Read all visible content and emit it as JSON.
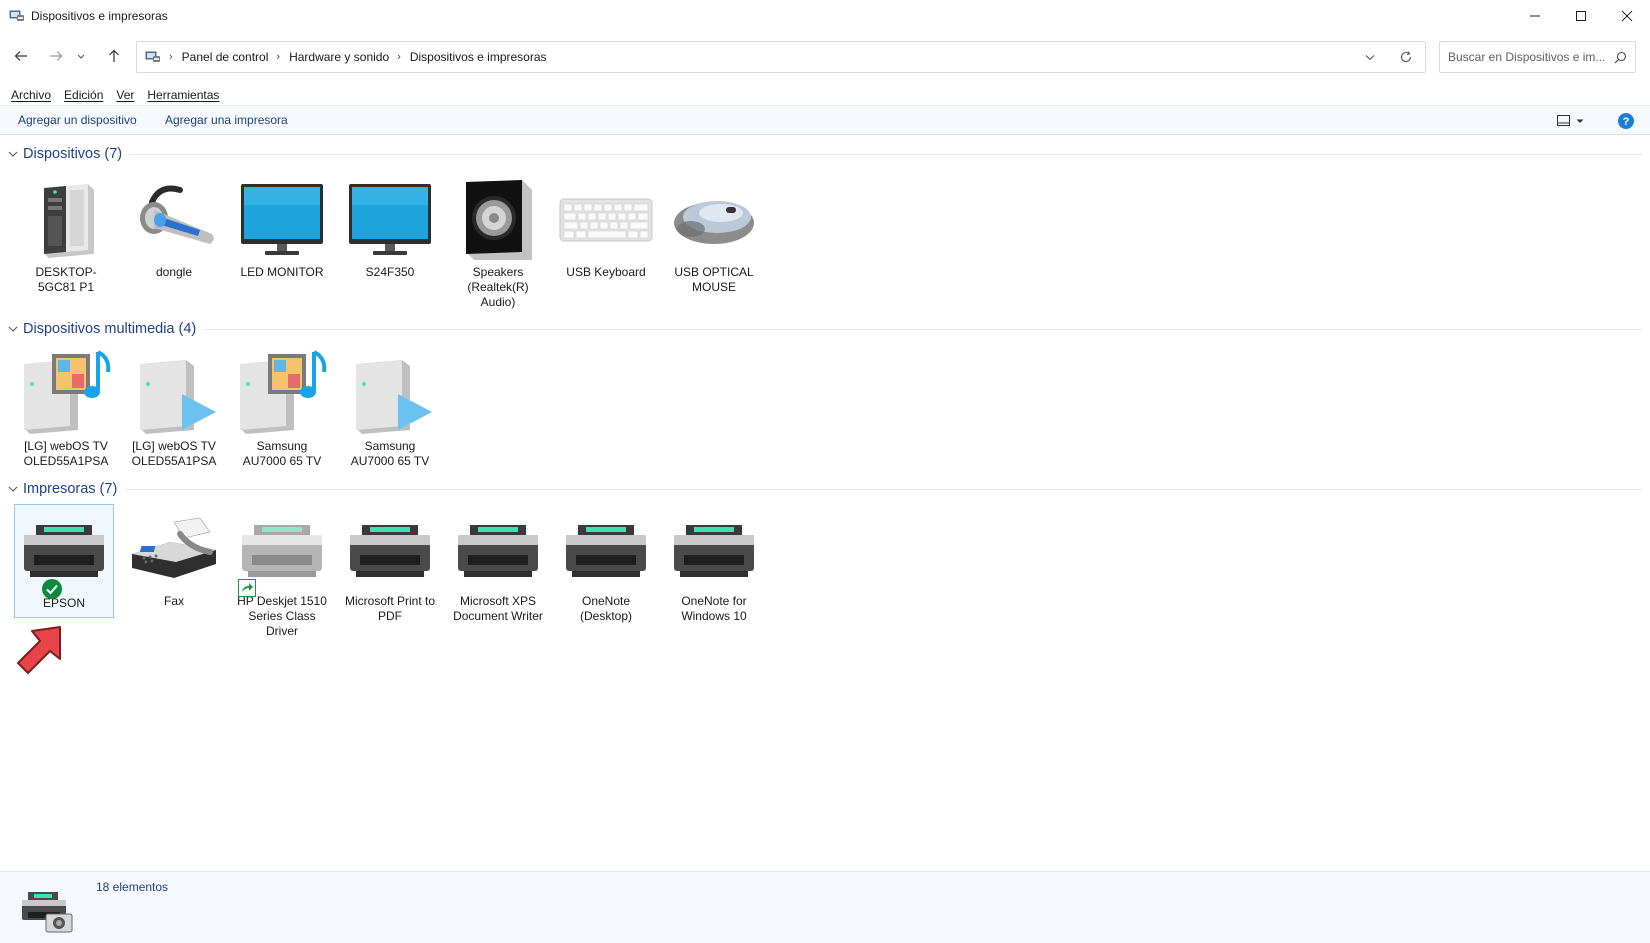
{
  "window": {
    "title": "Dispositivos e impresoras",
    "controls": [
      "minimize",
      "maximize",
      "close"
    ]
  },
  "nav": {
    "breadcrumb": [
      "Panel de control",
      "Hardware y sonido",
      "Dispositivos e impresoras"
    ],
    "search_placeholder": "Buscar en Dispositivos e im..."
  },
  "menu": [
    "Archivo",
    "Edición",
    "Ver",
    "Herramientas"
  ],
  "commands": {
    "add_device": "Agregar un dispositivo",
    "add_printer": "Agregar una impresora"
  },
  "groups": [
    {
      "title": "Dispositivos (7)",
      "items": [
        {
          "label": "DESKTOP-5GC81 P1",
          "icon": "computer-tower-icon"
        },
        {
          "label": "dongle",
          "icon": "bluetooth-headset-icon"
        },
        {
          "label": "LED MONITOR",
          "icon": "monitor-icon"
        },
        {
          "label": "S24F350",
          "icon": "monitor-icon"
        },
        {
          "label": "Speakers (Realtek(R) Audio)",
          "icon": "speaker-icon"
        },
        {
          "label": "USB Keyboard",
          "icon": "keyboard-icon"
        },
        {
          "label": "USB OPTICAL MOUSE",
          "icon": "mouse-icon"
        }
      ]
    },
    {
      "title": "Dispositivos multimedia (4)",
      "items": [
        {
          "label": "[LG] webOS TV OLED55A1PSA",
          "icon": "media-server-icon"
        },
        {
          "label": "[LG] webOS TV OLED55A1PSA",
          "icon": "media-renderer-icon"
        },
        {
          "label": "Samsung AU7000 65 TV",
          "icon": "media-server-icon"
        },
        {
          "label": "Samsung AU7000 65 TV",
          "icon": "media-renderer-icon"
        }
      ]
    },
    {
      "title": "Impresoras (7)",
      "items": [
        {
          "label": "EPSON",
          "icon": "printer-icon",
          "default": true
        },
        {
          "label": "Fax",
          "icon": "fax-icon"
        },
        {
          "label": "HP Deskjet 1510 Series Class Driver",
          "icon": "printer-shared-icon"
        },
        {
          "label": "Microsoft Print to PDF",
          "icon": "printer-icon"
        },
        {
          "label": "Microsoft XPS Document Writer",
          "icon": "printer-icon"
        },
        {
          "label": "OneNote (Desktop)",
          "icon": "printer-icon"
        },
        {
          "label": "OneNote for Windows 10",
          "icon": "printer-icon"
        }
      ]
    }
  ],
  "status": {
    "count_text": "18 elementos"
  },
  "colors": {
    "link_blue": "#1e3f8a",
    "command_bar_bg": "#f5f9fd",
    "selection_border": "#99c9ef",
    "default_check": "#0f8a3c",
    "arrow_red": "#e8454b"
  }
}
